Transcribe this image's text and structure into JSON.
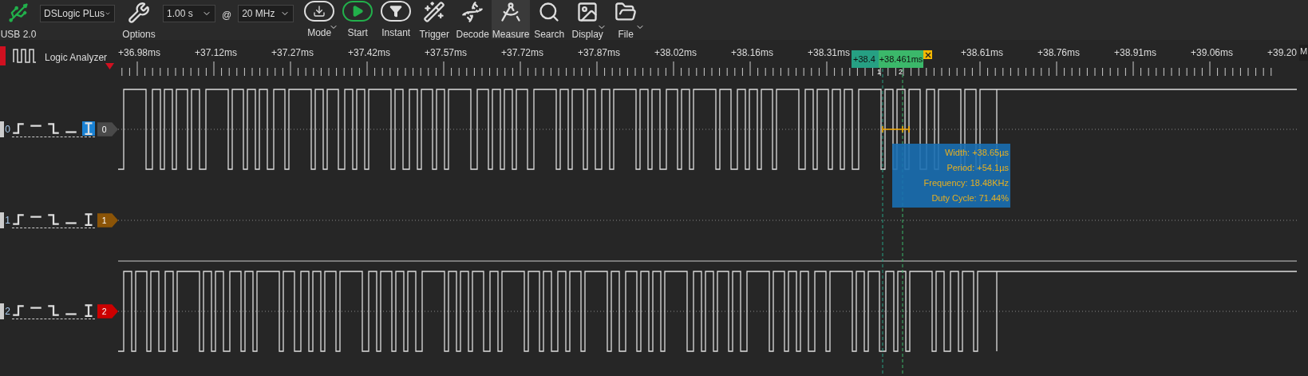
{
  "toolbar": {
    "usb_label": "USB 2.0",
    "device": {
      "value": "DSLogic PLus"
    },
    "options_label": "Options",
    "duration": {
      "value": "1.00 s"
    },
    "at_sign": "@",
    "rate": {
      "value": "20 MHz"
    },
    "buttons": [
      {
        "kind": "mode",
        "label": "Mode",
        "selected": false,
        "has_menu": true
      },
      {
        "kind": "start",
        "label": "Start",
        "selected": false,
        "has_menu": false
      },
      {
        "kind": "instant",
        "label": "Instant",
        "selected": false,
        "has_menu": false
      },
      {
        "kind": "trigger",
        "label": "Trigger",
        "selected": false,
        "has_menu": false
      },
      {
        "kind": "decode",
        "label": "Decode",
        "selected": false,
        "has_menu": false
      },
      {
        "kind": "measure",
        "label": "Measure",
        "selected": true,
        "has_menu": false
      },
      {
        "kind": "search",
        "label": "Search",
        "selected": false,
        "has_menu": false
      },
      {
        "kind": "display",
        "label": "Display",
        "selected": false,
        "has_menu": true
      },
      {
        "kind": "file",
        "label": "File",
        "selected": false,
        "has_menu": true
      }
    ]
  },
  "ruler": {
    "title": "Logic Analyzer",
    "side_tab": "M",
    "ticks_before_cursor": [
      "+36.98ms",
      "+37.12ms",
      "+37.27ms",
      "+37.42ms",
      "+37.57ms",
      "+37.72ms",
      "+37.87ms",
      "+38.02ms",
      "+38.16ms",
      "+38.31ms"
    ],
    "ticks_after_cursor": [
      "+38.61ms",
      "+38.76ms",
      "+38.91ms",
      "+39.06ms",
      "+39.20"
    ]
  },
  "cursors": [
    {
      "time": "+38.4",
      "index": "1",
      "color": "#26a083"
    },
    {
      "time": "+38.461ms",
      "index": "2",
      "color": "#3bb86a"
    }
  ],
  "channels": [
    {
      "index": "0",
      "badge": "0",
      "color": "#4a4a4a",
      "kind": "pulses",
      "triggers": [
        {
          "kind": "rise",
          "selected": false
        },
        {
          "kind": "high",
          "selected": false
        },
        {
          "kind": "fall",
          "selected": false
        },
        {
          "kind": "low",
          "selected": false
        },
        {
          "kind": "edge",
          "selected": true
        }
      ]
    },
    {
      "index": "1",
      "badge": "1",
      "color": "#8b5407",
      "kind": "flat",
      "triggers": [
        {
          "kind": "rise",
          "selected": false
        },
        {
          "kind": "high",
          "selected": false
        },
        {
          "kind": "fall",
          "selected": false
        },
        {
          "kind": "low",
          "selected": false
        },
        {
          "kind": "edge",
          "selected": false
        }
      ]
    },
    {
      "index": "2",
      "badge": "2",
      "color": "#cc0000",
      "kind": "pulses",
      "triggers": [
        {
          "kind": "rise",
          "selected": false
        },
        {
          "kind": "high",
          "selected": false
        },
        {
          "kind": "fall",
          "selected": false
        },
        {
          "kind": "low",
          "selected": false
        },
        {
          "kind": "edge",
          "selected": false
        }
      ]
    }
  ],
  "measurement": [
    "Width: +38.65µs",
    "Period: +54.1µs",
    "Frequency: 18.48KHz",
    "Duty Cycle: 71.44%"
  ]
}
